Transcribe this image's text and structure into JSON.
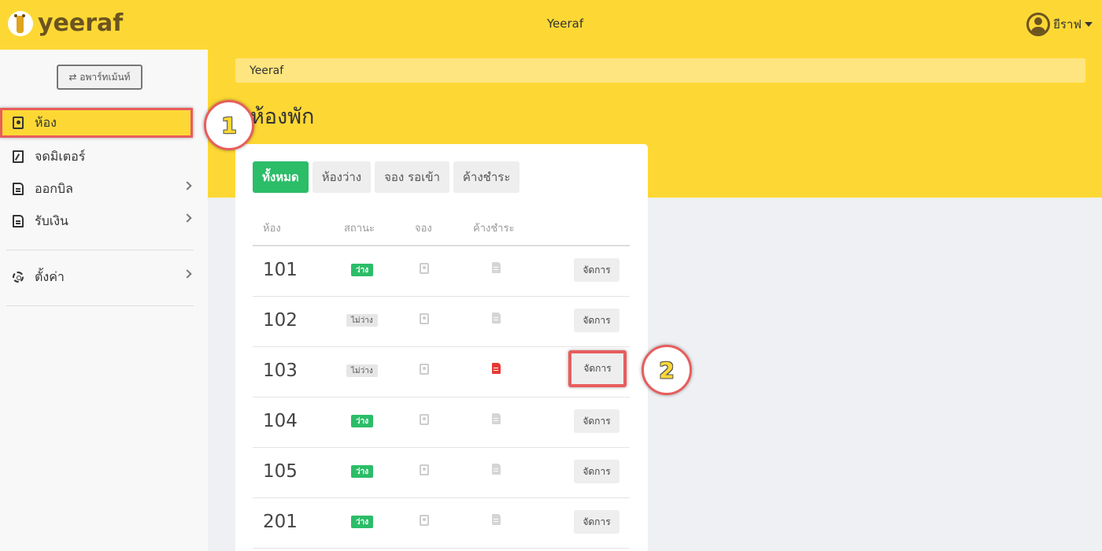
{
  "header": {
    "logo_text": "yeeraf",
    "app_title": "Yeeraf",
    "user_name": "ยีราฟ"
  },
  "sidebar": {
    "apartment_button": "⇄ อพาร์ทเม้นท์",
    "items": [
      {
        "label": "ห้อง",
        "icon": "room-icon",
        "active": true
      },
      {
        "label": "จดมิเตอร์",
        "icon": "meter-icon"
      },
      {
        "label": "ออกบิล",
        "icon": "bill-icon",
        "expandable": true
      },
      {
        "label": "รับเงิน",
        "icon": "payment-icon",
        "expandable": true
      },
      {
        "label": "ตั้งค่า",
        "icon": "gear-icon",
        "expandable": true
      }
    ]
  },
  "main": {
    "breadcrumb": "Yeeraf",
    "page_title": "ห้องพัก",
    "tabs": [
      "ทั้งหมด",
      "ห้องว่าง",
      "จอง รอเข้า",
      "ค้างชำระ"
    ],
    "active_tab": "ทั้งหมด",
    "columns": [
      "ห้อง",
      "สถานะ",
      "จอง",
      "ค้างชำระ"
    ],
    "manage_label": "จัดการ",
    "rows": [
      {
        "room": "101",
        "status": "ว่าง",
        "status_type": "free",
        "overdue": false
      },
      {
        "room": "102",
        "status": "ไม่ว่าง",
        "status_type": "busy",
        "overdue": false
      },
      {
        "room": "103",
        "status": "ไม่ว่าง",
        "status_type": "busy",
        "overdue": true
      },
      {
        "room": "104",
        "status": "ว่าง",
        "status_type": "free",
        "overdue": false
      },
      {
        "room": "105",
        "status": "ว่าง",
        "status_type": "free",
        "overdue": false
      },
      {
        "room": "201",
        "status": "ว่าง",
        "status_type": "free",
        "overdue": false
      }
    ]
  },
  "callouts": [
    "1",
    "2"
  ],
  "colors": {
    "brand_yellow": "#fdd835",
    "accent_green": "#2bbd68",
    "highlight_red": "#e85d5d",
    "overdue_red": "#e53935"
  }
}
